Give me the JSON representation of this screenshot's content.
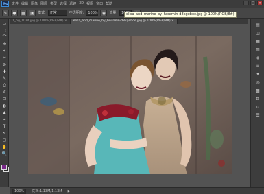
{
  "app": {
    "logo": "Ps"
  },
  "menus": [
    "文件",
    "编辑",
    "图像",
    "图层",
    "类型",
    "选择",
    "滤镜",
    "3D",
    "视图",
    "窗口",
    "帮助"
  ],
  "window_buttons": [
    "−",
    "□",
    "×"
  ],
  "options": {
    "mode_value": "正常",
    "opacity_label": "不透明度:",
    "opacity_value": "100%",
    "flow_label": "流量:",
    "flow_value": "100%"
  },
  "tooltip": "elisa_and_marine_by_hourmin-d8kgeboe.jpg @ 100%(RGB/8#)",
  "tabs": [
    {
      "label": "1_bg_1024.jpg @ 100%(RGB/8#) ×"
    },
    {
      "label": "elisa_and_marine_by_hourmin-d8kgeboe.jpg @ 100%(RGB/8#) ×"
    }
  ],
  "tools": [
    "▭",
    "⬚",
    "⌒",
    "✣",
    "⌖",
    "✂",
    "⊘",
    "✚",
    "✎",
    "⎙",
    "✐",
    "⊟",
    "◐",
    "▲",
    "✒",
    "T",
    "↖",
    "▢",
    "✋",
    "🔍"
  ],
  "right_icons": [
    "▤",
    "◫",
    "▦",
    "▧",
    "◈",
    "≡",
    "✦",
    "◎",
    "▩",
    "⊞",
    "⊡",
    "☰"
  ],
  "status": {
    "zoom": "100%",
    "doc_info": "文档:1.13M/1.13M",
    "arrow": "▶"
  },
  "colors": {
    "foreground": "#7a2a8a",
    "background": "#2a2a2a",
    "accent": "#3a8bd6"
  }
}
